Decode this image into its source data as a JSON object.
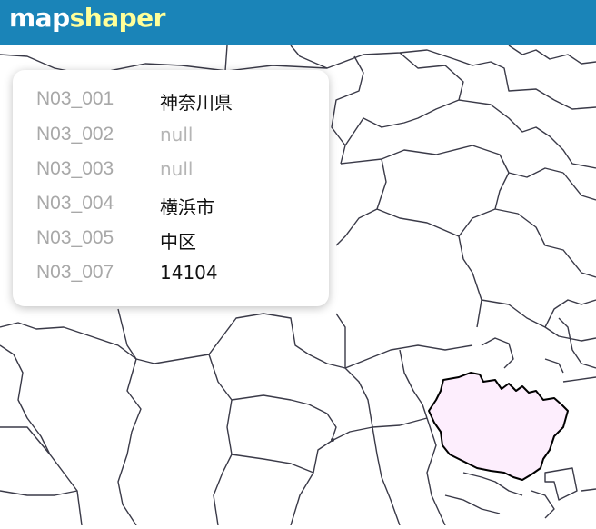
{
  "app": {
    "logo_part1": "map",
    "logo_part2": "shaper"
  },
  "popup": {
    "rows": [
      {
        "key": "N03_001",
        "value": "神奈川県"
      },
      {
        "key": "N03_002",
        "value": "null"
      },
      {
        "key": "N03_003",
        "value": "null"
      },
      {
        "key": "N03_004",
        "value": "横浜市"
      },
      {
        "key": "N03_005",
        "value": "中区"
      },
      {
        "key": "N03_007",
        "value": "14104"
      }
    ]
  },
  "colors": {
    "header": "#1a84b8",
    "selected_fill": "#fdeefd",
    "boundary": "#3a3a48"
  }
}
